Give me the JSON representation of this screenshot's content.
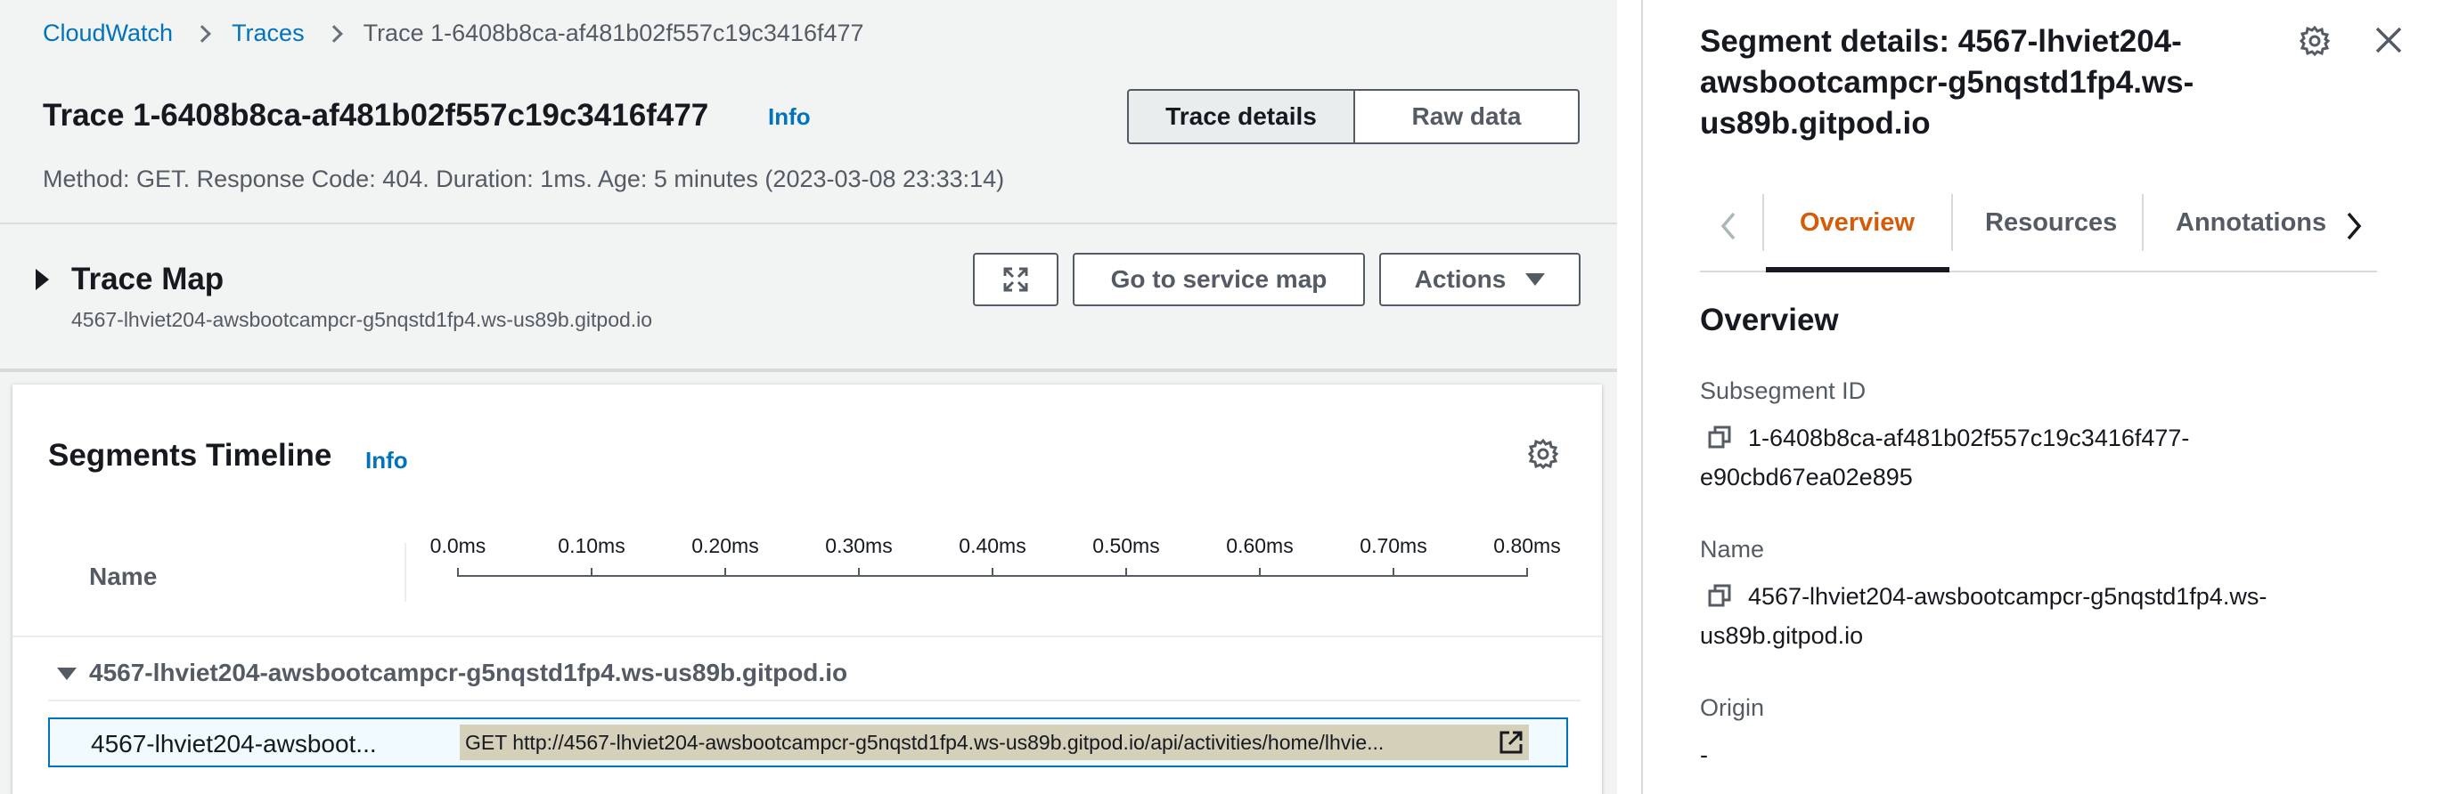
{
  "breadcrumb": {
    "items": [
      "CloudWatch",
      "Traces"
    ],
    "current": "Trace 1-6408b8ca-af481b02f557c19c3416f477"
  },
  "header": {
    "title": "Trace 1-6408b8ca-af481b02f557c19c3416f477",
    "info": "Info",
    "view_tabs": [
      "Trace details",
      "Raw data"
    ],
    "description": "Method: GET. Response Code: 404. Duration: 1ms. Age: 5 minutes (2023-03-08 23:33:14)"
  },
  "trace_map": {
    "title": "Trace Map",
    "subtitle": "4567-lhviet204-awsbootcampcr-g5nqstd1fp4.ws-us89b.gitpod.io",
    "service_map_label": "Go to service map",
    "actions_label": "Actions"
  },
  "timeline": {
    "title": "Segments Timeline",
    "info": "Info",
    "name_header": "Name",
    "ticks": [
      "0.0ms",
      "0.10ms",
      "0.20ms",
      "0.30ms",
      "0.40ms",
      "0.50ms",
      "0.60ms",
      "0.70ms",
      "0.80ms"
    ],
    "group_name": "4567-lhviet204-awsbootcampcr-g5nqstd1fp4.ws-us89b.gitpod.io",
    "row_name": "4567-lhviet204-awsboot...",
    "row_bar_text": "GET http://4567-lhviet204-awsbootcampcr-g5nqstd1fp4.ws-us89b.gitpod.io/api/activities/home/lhvie..."
  },
  "panel": {
    "title": "Segment details: 4567-lhviet204-awsbootcampcr-g5nqstd1fp4.ws-us89b.gitpod.io",
    "tabs": [
      "Overview",
      "Resources",
      "Annotations"
    ],
    "active_tab": "Overview",
    "section_title": "Overview",
    "fields": {
      "subsegment_label": "Subsegment ID",
      "subsegment_value": "1-6408b8ca-af481b02f557c19c3416f477-e90cbd67ea02e895",
      "name_label": "Name",
      "name_value": "4567-lhviet204-awsbootcampcr-g5nqstd1fp4.ws-us89b.gitpod.io",
      "origin_label": "Origin",
      "origin_value": "-"
    }
  },
  "colors": {
    "link": "#0073bb",
    "active_tab": "#d45b07",
    "segment_bar": "#d5d0b9",
    "selected_row_border": "#0073bb"
  }
}
